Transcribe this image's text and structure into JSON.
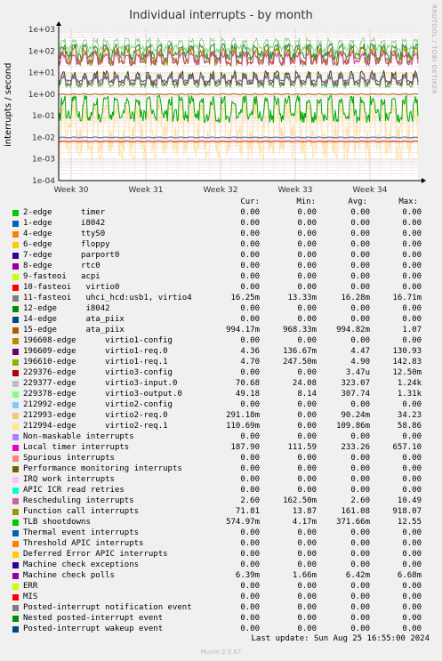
{
  "title": "Individual interrupts - by month",
  "side_text": "RRDTOOL / TOBI OETIKER",
  "ylabel": "interrupts / second",
  "chart_data": {
    "type": "line",
    "title": "Individual interrupts - by month",
    "ylabel": "interrupts / second",
    "yscale": "log",
    "ylim": [
      0.0001,
      1000
    ],
    "y_ticks": [
      "1e+03",
      "1e+02",
      "1e+01",
      "1e+00",
      "1e-01",
      "1e-02",
      "1e-03",
      "1e-04"
    ],
    "x_ticks": [
      "Week 30",
      "Week 31",
      "Week 32",
      "Week 33",
      "Week 34"
    ],
    "grid": true,
    "series": [
      {
        "name": "Local timer interrupts",
        "color": "#8fd18f",
        "low": 80,
        "high": 400,
        "base": 190
      },
      {
        "name": "TLB shootdowns",
        "color": "#2e8b2e",
        "low": 30,
        "high": 220,
        "base": 100
      },
      {
        "name": "Function call interrupts",
        "color": "#8a8a00",
        "low": 18,
        "high": 150,
        "base": 55
      },
      {
        "name": "Rescheduling interrupts",
        "color": "#cc4488",
        "low": 20,
        "high": 90,
        "base": 40
      },
      {
        "name": "229377-edge virtio3-input.0",
        "color": "#5c3a00",
        "low": 2.5,
        "high": 12,
        "base": 4
      },
      {
        "name": "229378-edge virtio3-output.0",
        "color": "#4a9a4a",
        "low": 2,
        "high": 9,
        "base": 3.2
      },
      {
        "name": "212993-edge virtio2-req.0",
        "color": "#ffd9a0",
        "low": 0.001,
        "high": 0.6,
        "base": 0.05
      },
      {
        "name": "212994-edge virtio2-req.1",
        "color": "#ffe6b3",
        "low": 0.0005,
        "high": 0.3,
        "base": 0.02
      },
      {
        "name": "11-fasteoi uhci_hcd:usb1, virtio4",
        "color": "#00aa00",
        "low": 0.04,
        "high": 0.9,
        "base": 0.2
      },
      {
        "name": "15-edge ata_piix",
        "color": "#aa6600",
        "low": 0.95,
        "high": 1.05,
        "base": 0.99
      },
      {
        "name": "196610-edge virtio1-req.1",
        "color": "#8a4a9a",
        "low": 3.5,
        "high": 6.5,
        "base": 4.7
      },
      {
        "name": "Machine check polls",
        "color": "#cc2222",
        "low": 0.0062,
        "high": 0.0068,
        "base": 0.0064
      },
      {
        "name": "Thermal event interrupts",
        "color": "#4466cc",
        "low": 0.0095,
        "high": 0.0105,
        "base": 0.01
      },
      {
        "name": "229376-edge virtio3-config",
        "color": "#cc0000",
        "low": 0.0001,
        "high": 0.0001,
        "base": 0.0001
      }
    ]
  },
  "legend_header": {
    "cur": "Cur:",
    "min": "Min:",
    "avg": "Avg:",
    "max": "Max:"
  },
  "legend": [
    {
      "name": "2-edge      timer",
      "color": "#00cc00",
      "cur": "0.00",
      "min": "0.00",
      "avg": "0.00",
      "max": "0.00"
    },
    {
      "name": "1-edge      i8042",
      "color": "#0066b3",
      "cur": "0.00",
      "min": "0.00",
      "avg": "0.00",
      "max": "0.00"
    },
    {
      "name": "4-edge      ttyS0",
      "color": "#ff8000",
      "cur": "0.00",
      "min": "0.00",
      "avg": "0.00",
      "max": "0.00"
    },
    {
      "name": "6-edge      floppy",
      "color": "#ffcc00",
      "cur": "0.00",
      "min": "0.00",
      "avg": "0.00",
      "max": "0.00"
    },
    {
      "name": "7-edge      parport0",
      "color": "#330099",
      "cur": "0.00",
      "min": "0.00",
      "avg": "0.00",
      "max": "0.00"
    },
    {
      "name": "8-edge      rtc0",
      "color": "#990099",
      "cur": "0.00",
      "min": "0.00",
      "avg": "0.00",
      "max": "0.00"
    },
    {
      "name": "9-fasteoi   acpi",
      "color": "#ccff00",
      "cur": "0.00",
      "min": "0.00",
      "avg": "0.00",
      "max": "0.00"
    },
    {
      "name": "10-fasteoi   virtio0",
      "color": "#ff0000",
      "cur": "0.00",
      "min": "0.00",
      "avg": "0.00",
      "max": "0.00"
    },
    {
      "name": "11-fasteoi   uhci_hcd:usb1, virtio4",
      "color": "#808080",
      "cur": "16.25m",
      "min": "13.33m",
      "avg": "16.28m",
      "max": "16.71m"
    },
    {
      "name": "12-edge      i8042",
      "color": "#008f00",
      "cur": "0.00",
      "min": "0.00",
      "avg": "0.00",
      "max": "0.00"
    },
    {
      "name": "14-edge      ata_piix",
      "color": "#00487d",
      "cur": "0.00",
      "min": "0.00",
      "avg": "0.00",
      "max": "0.00"
    },
    {
      "name": "15-edge      ata_piix",
      "color": "#b35a00",
      "cur": "994.17m",
      "min": "968.33m",
      "avg": "994.82m",
      "max": "1.07"
    },
    {
      "name": "196608-edge      virtio1-config",
      "color": "#b38f00",
      "cur": "0.00",
      "min": "0.00",
      "avg": "0.00",
      "max": "0.00"
    },
    {
      "name": "196609-edge      virtio1-req.0",
      "color": "#6b006b",
      "cur": "4.36",
      "min": "136.67m",
      "avg": "4.47",
      "max": "130.93"
    },
    {
      "name": "196610-edge      virtio1-req.1",
      "color": "#8fb300",
      "cur": "4.70",
      "min": "247.50m",
      "avg": "4.90",
      "max": "142.83"
    },
    {
      "name": "229376-edge      virtio3-config",
      "color": "#b30000",
      "cur": "0.00",
      "min": "0.00",
      "avg": "3.47u",
      "max": "12.50m"
    },
    {
      "name": "229377-edge      virtio3-input.0",
      "color": "#bebebe",
      "cur": "70.68",
      "min": "24.08",
      "avg": "323.07",
      "max": "1.24k"
    },
    {
      "name": "229378-edge      virtio3-output.0",
      "color": "#80ff80",
      "cur": "49.18",
      "min": "8.14",
      "avg": "307.74",
      "max": "1.31k"
    },
    {
      "name": "212992-edge      virtio2-config",
      "color": "#80c9ff",
      "cur": "0.00",
      "min": "0.00",
      "avg": "0.00",
      "max": "0.00"
    },
    {
      "name": "212993-edge      virtio2-req.0",
      "color": "#ffc080",
      "cur": "291.18m",
      "min": "0.00",
      "avg": "90.24m",
      "max": "34.23"
    },
    {
      "name": "212994-edge      virtio2-req.1",
      "color": "#ffe680",
      "cur": "110.69m",
      "min": "0.00",
      "avg": "109.86m",
      "max": "58.86"
    },
    {
      "name": "Non-maskable interrupts",
      "color": "#aa80ff",
      "cur": "0.00",
      "min": "0.00",
      "avg": "0.00",
      "max": "0.00"
    },
    {
      "name": "Local timer interrupts",
      "color": "#ee00cc",
      "cur": "187.90",
      "min": "111.59",
      "avg": "233.26",
      "max": "657.10"
    },
    {
      "name": "Spurious interrupts",
      "color": "#ff8080",
      "cur": "0.00",
      "min": "0.00",
      "avg": "0.00",
      "max": "0.00"
    },
    {
      "name": "Performance monitoring interrupts",
      "color": "#666600",
      "cur": "0.00",
      "min": "0.00",
      "avg": "0.00",
      "max": "0.00"
    },
    {
      "name": "IRQ work interrupts",
      "color": "#ffbfff",
      "cur": "0.00",
      "min": "0.00",
      "avg": "0.00",
      "max": "0.00"
    },
    {
      "name": "APIC ICR read retries",
      "color": "#00ffcc",
      "cur": "0.00",
      "min": "0.00",
      "avg": "0.00",
      "max": "0.00"
    },
    {
      "name": "Rescheduling interrupts",
      "color": "#cc6699",
      "cur": "2.60",
      "min": "162.50m",
      "avg": "2.60",
      "max": "10.49"
    },
    {
      "name": "Function call interrupts",
      "color": "#999900",
      "cur": "71.81",
      "min": "13.87",
      "avg": "161.08",
      "max": "918.07"
    },
    {
      "name": "TLB shootdowns",
      "color": "#00cc00",
      "cur": "574.97m",
      "min": "4.17m",
      "avg": "371.66m",
      "max": "12.55"
    },
    {
      "name": "Thermal event interrupts",
      "color": "#0066b3",
      "cur": "0.00",
      "min": "0.00",
      "avg": "0.00",
      "max": "0.00"
    },
    {
      "name": "Threshold APIC interrupts",
      "color": "#ff8000",
      "cur": "0.00",
      "min": "0.00",
      "avg": "0.00",
      "max": "0.00"
    },
    {
      "name": "Deferred Error APIC interrupts",
      "color": "#ffcc00",
      "cur": "0.00",
      "min": "0.00",
      "avg": "0.00",
      "max": "0.00"
    },
    {
      "name": "Machine check exceptions",
      "color": "#330099",
      "cur": "0.00",
      "min": "0.00",
      "avg": "0.00",
      "max": "0.00"
    },
    {
      "name": "Machine check polls",
      "color": "#990099",
      "cur": "6.39m",
      "min": "1.66m",
      "avg": "6.42m",
      "max": "6.68m"
    },
    {
      "name": "ERR",
      "color": "#ccff00",
      "cur": "0.00",
      "min": "0.00",
      "avg": "0.00",
      "max": "0.00"
    },
    {
      "name": "MIS",
      "color": "#ff0000",
      "cur": "0.00",
      "min": "0.00",
      "avg": "0.00",
      "max": "0.00"
    },
    {
      "name": "Posted-interrupt notification event",
      "color": "#808080",
      "cur": "0.00",
      "min": "0.00",
      "avg": "0.00",
      "max": "0.00"
    },
    {
      "name": "Nested posted-interrupt event",
      "color": "#008f00",
      "cur": "0.00",
      "min": "0.00",
      "avg": "0.00",
      "max": "0.00"
    },
    {
      "name": "Posted-interrupt wakeup event",
      "color": "#00487d",
      "cur": "0.00",
      "min": "0.00",
      "avg": "0.00",
      "max": "0.00"
    }
  ],
  "last_update": "Last update: Sun Aug 25 16:55:00 2024",
  "munin_version": "Munin 2.0.67"
}
